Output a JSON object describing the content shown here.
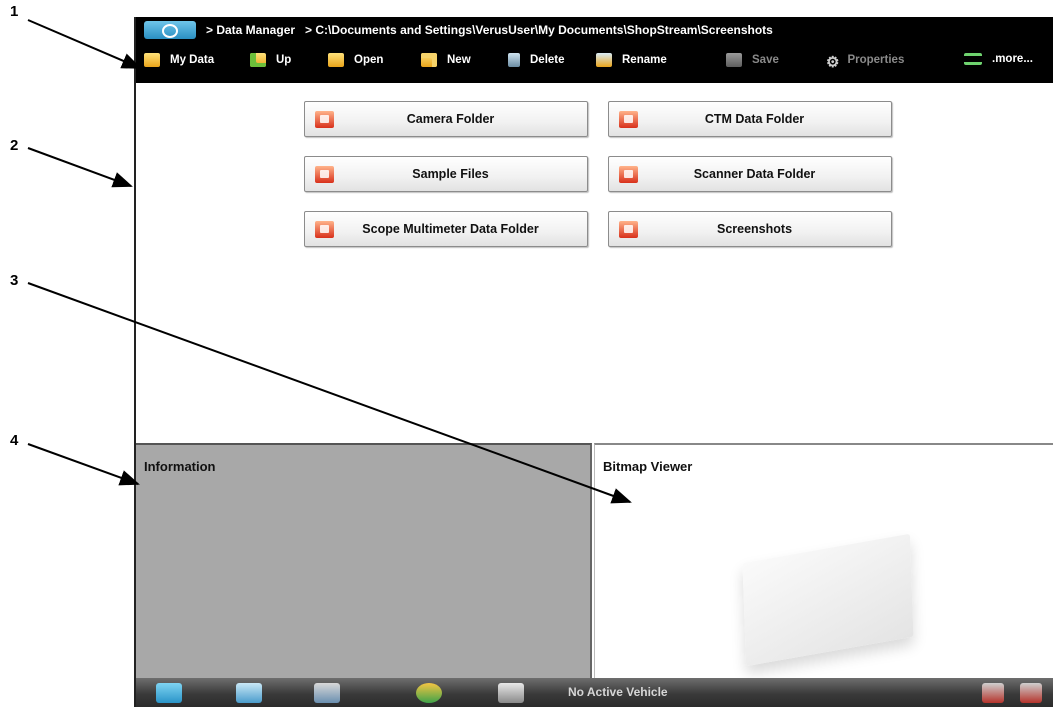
{
  "callouts": [
    "1",
    "2",
    "3",
    "4"
  ],
  "header": {
    "app_name": "> Data Manager",
    "path": "> C:\\Documents and Settings\\VerusUser\\My Documents\\ShopStream\\Screenshots"
  },
  "toolbar": {
    "my_data": "My Data",
    "up": "Up",
    "open": "Open",
    "new": "New",
    "delete": "Delete",
    "rename": "Rename",
    "save": "Save",
    "properties": "Properties",
    "more": ".more..."
  },
  "folders": [
    {
      "label": "Camera Folder",
      "icon": "camera-folder-icon"
    },
    {
      "label": "CTM Data Folder",
      "icon": "ctm-folder-icon"
    },
    {
      "label": "Sample Files",
      "icon": "snapon-folder-icon"
    },
    {
      "label": "Scanner Data Folder",
      "icon": "scanner-folder-icon"
    },
    {
      "label": "Scope Multimeter Data Folder",
      "icon": "scope-folder-icon"
    },
    {
      "label": "Screenshots",
      "icon": "snapon-folder-icon"
    }
  ],
  "panels": {
    "information": "Information",
    "bitmap_viewer": "Bitmap Viewer"
  },
  "taskbar": {
    "status": "No Active Vehicle"
  },
  "colors": {
    "toolbar_bg": "#000000",
    "info_bg": "#a8a8a8",
    "folder_icon": "#d8301b",
    "disabled_text": "#8a8a8a"
  }
}
